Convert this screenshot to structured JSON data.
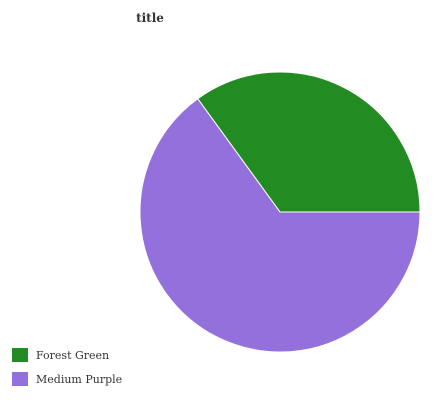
{
  "chart_data": {
    "type": "pie",
    "title": "title",
    "categories": [
      "Forest Green",
      "Medium Purple"
    ],
    "values": [
      35,
      65
    ],
    "colors": [
      "#228b22",
      "#9370db"
    ],
    "legend_position": "bottom-left"
  }
}
